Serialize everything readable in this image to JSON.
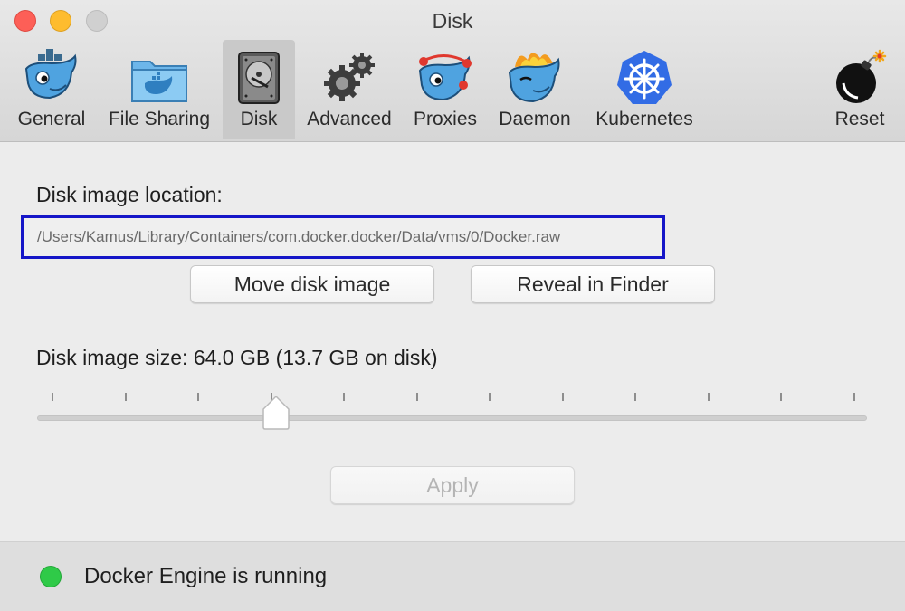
{
  "window": {
    "title": "Disk"
  },
  "toolbar": {
    "items": [
      {
        "label": "General",
        "icon": "docker-whale-icon"
      },
      {
        "label": "File Sharing",
        "icon": "folder-whale-icon"
      },
      {
        "label": "Disk",
        "icon": "hard-disk-icon",
        "selected": true
      },
      {
        "label": "Advanced",
        "icon": "gears-icon"
      },
      {
        "label": "Proxies",
        "icon": "proxy-whale-icon"
      },
      {
        "label": "Daemon",
        "icon": "daemon-whale-icon"
      },
      {
        "label": "Kubernetes",
        "icon": "kubernetes-helm-icon"
      },
      {
        "label": "Reset",
        "icon": "bomb-icon"
      }
    ]
  },
  "disk": {
    "location_label": "Disk image location:",
    "location_path": "/Users/Kamus/Library/Containers/com.docker.docker/Data/vms/0/Docker.raw",
    "move_button": "Move disk image",
    "reveal_button": "Reveal in Finder",
    "size_label": "Disk image size: 64.0 GB (13.7 GB on disk)",
    "slider": {
      "ticks": 12,
      "position_fraction": 0.28
    },
    "apply_button": "Apply"
  },
  "status": {
    "text": "Docker Engine is running",
    "indicator_color": "#2fca48"
  },
  "colors": {
    "highlight_border": "#1516c8",
    "kubernetes_blue": "#326ce5"
  }
}
